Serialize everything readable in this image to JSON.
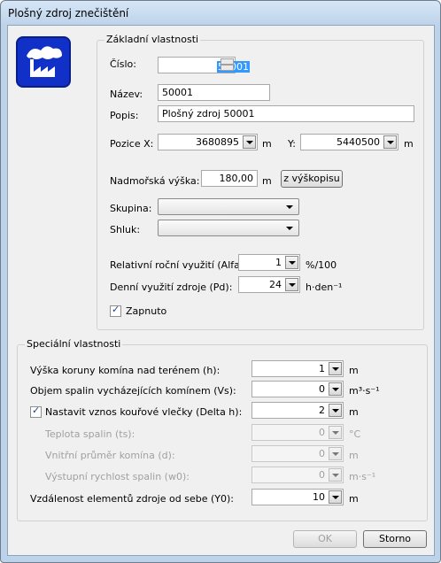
{
  "window": {
    "title": "Plošný zdroj znečištění"
  },
  "basic": {
    "group_label": "Základní vlastnosti",
    "cislo_label": "Číslo:",
    "cislo_value": "50001",
    "nazev_label": "Název:",
    "nazev_value": "50001",
    "popis_label": "Popis:",
    "popis_value": "Plošný zdroj 50001",
    "pozice_x_label": "Pozice X:",
    "pozice_x_value": "3680895",
    "pozice_x_unit": "m",
    "y_label": "Y:",
    "y_value": "5440500",
    "y_unit": "m",
    "vyska_label": "Nadmořská výška:",
    "vyska_value": "180,00",
    "vyska_unit": "m",
    "vyskopis_button": "z výškopisu",
    "skupina_label": "Skupina:",
    "shluk_label": "Shluk:",
    "alfa_label": "Relativní roční využití  (Alfa)",
    "alfa_value": "1",
    "alfa_unit": "%/100",
    "pd_label": "Denní využití zdroje (Pd):",
    "pd_value": "24",
    "pd_unit": "h·den⁻¹",
    "zapnuto_label": "Zapnuto"
  },
  "special": {
    "group_label": "Speciální vlastnosti",
    "rows": [
      {
        "label": "Výška koruny komína nad terénem (h):",
        "value": "1",
        "unit": "m"
      },
      {
        "label": "Objem spalin vycházejících komínem (Vs):",
        "value": "0",
        "unit": "m³·s⁻¹"
      },
      {
        "label": "Nastavit vznos kouřové vlečky (Delta h):",
        "value": "2",
        "unit": "m"
      },
      {
        "label": "Teplota spalin (ts):",
        "value": "0",
        "unit": "°C"
      },
      {
        "label": "Vnitřní průměr komína (d):",
        "value": "0",
        "unit": "m"
      },
      {
        "label": "Výstupní rychlost spalin (w0):",
        "value": "0",
        "unit": "m·s⁻¹"
      },
      {
        "label": "Vzdálenost elementů zdroje od sebe (Y0):",
        "value": "10",
        "unit": "m"
      }
    ]
  },
  "buttons": {
    "ok": "OK",
    "cancel": "Storno"
  },
  "colors": {
    "logo_bg": "#1030c8",
    "title_bar": "#bdd3ea"
  },
  "icons": {
    "logo": "factory-smog-icon"
  }
}
